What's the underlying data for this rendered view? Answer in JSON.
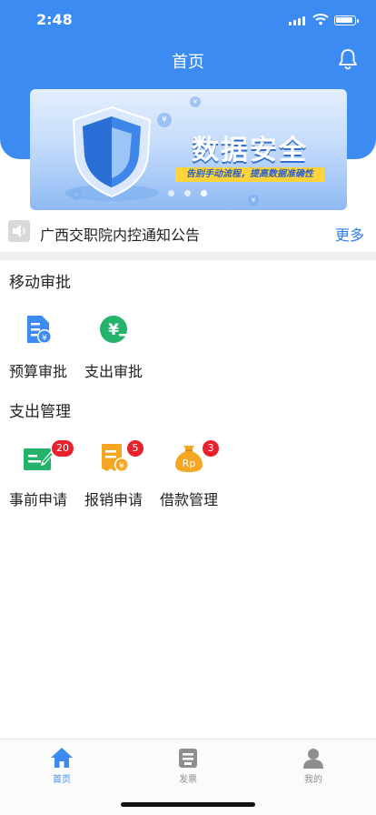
{
  "status_bar": {
    "time": "2:48"
  },
  "header": {
    "title": "首页"
  },
  "banner": {
    "headline": "数据安全",
    "subline": "告别手动流程，提高数据准确性",
    "page_count": 3,
    "active_page": 3
  },
  "notice": {
    "text": "广西交职院内控通知公告",
    "more_label": "更多"
  },
  "sections": [
    {
      "title": "移动审批",
      "items": [
        {
          "label": "预算审批",
          "icon": "budget-doc-icon"
        },
        {
          "label": "支出审批",
          "icon": "yuan-coin-icon"
        }
      ]
    },
    {
      "title": "支出管理",
      "items": [
        {
          "label": "事前申请",
          "icon": "pre-application-icon",
          "badge": "20"
        },
        {
          "label": "报销申请",
          "icon": "reimbursement-icon",
          "badge": "5"
        },
        {
          "label": "借款管理",
          "icon": "loan-bag-icon",
          "badge": "3"
        }
      ]
    }
  ],
  "tab_bar": [
    {
      "label": "首页",
      "icon": "home-icon",
      "active": true
    },
    {
      "label": "发票",
      "icon": "invoice-icon",
      "active": false
    },
    {
      "label": "我的",
      "icon": "profile-icon",
      "active": false
    }
  ],
  "colors": {
    "primary": "#3b8bf2",
    "badge": "#e8222d",
    "green": "#23b36b",
    "orange": "#f5a623",
    "link": "#2f7de7",
    "tab_inactive": "#8e8e8e"
  }
}
